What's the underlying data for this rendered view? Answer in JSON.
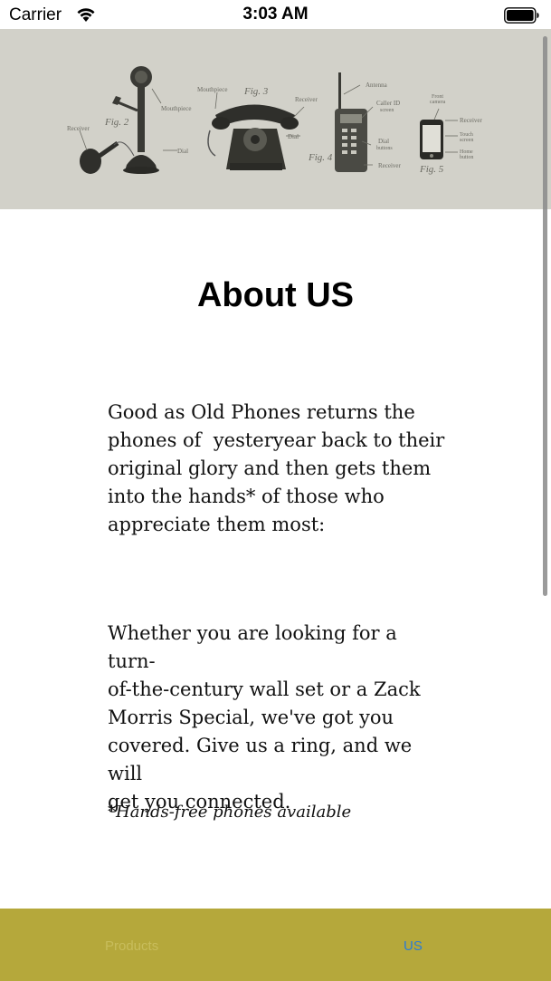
{
  "status_bar": {
    "carrier": "Carrier",
    "time": "3:03 AM"
  },
  "banner": {
    "labels": {
      "receiver_1": "Receiver",
      "fig2": "Fig. 2",
      "mouthpiece_1": "Mouthpiece",
      "dial_1": "Dial",
      "mouthpiece_2": "Mouthpiece",
      "fig3": "Fig. 3",
      "receiver_2": "Receiver",
      "dial_2": "Dial",
      "antenna": "Antenna",
      "caller_id": "Caller ID",
      "caller_id_2": "screen",
      "dial_buttons": "Dial",
      "dial_buttons_2": "buttons",
      "receiver_3": "Receiver",
      "fig4": "Fig. 4",
      "front_camera": "Front",
      "front_camera_2": "camera",
      "receiver_4": "Receiver",
      "touch_screen": "Touch",
      "touch_screen_2": "screen",
      "home_button": "Home",
      "home_button_2": "button",
      "fig5": "Fig. 5"
    },
    "colors": {
      "background": "#d2d1c9",
      "ink": "#4a4a44"
    }
  },
  "content": {
    "title": "About US",
    "paragraph1_lines": [
      "Good as Old Phones returns the",
      "phones of  yesteryear back to their",
      "original glory and then gets them",
      "into the hands* of those who",
      "appreciate them most:"
    ],
    "paragraph2_lines": [
      "Whether you are looking for a turn-",
      "of-the-century wall set or a Zack",
      "Morris Special, we've got you",
      "covered. Give us a ring, and we will",
      "get you connected."
    ],
    "footnote": "*Hands-free phones available"
  },
  "tab_bar": {
    "tabs": [
      {
        "label": "Products",
        "selected": false
      },
      {
        "label": "US",
        "selected": true
      }
    ],
    "colors": {
      "background": "#b5a83b",
      "selected": "#2a7bd6",
      "unselected": "#c8bd5c"
    }
  }
}
